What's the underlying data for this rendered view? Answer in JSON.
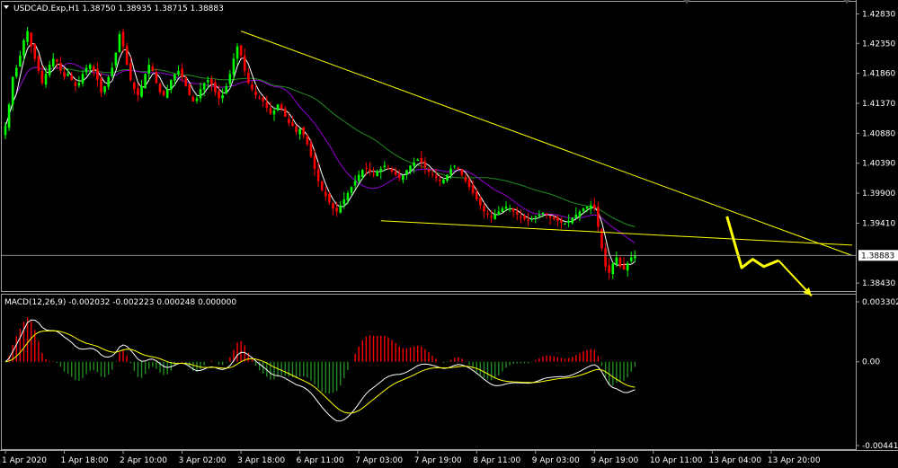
{
  "chart_data": [
    {
      "type": "line",
      "title": "USDCAD.Exp,H1  1.38750 1.38935 1.38715 1.38883",
      "symbol": "USDCAD.Exp,H1",
      "ohlc": [
        "1.38750",
        "1.38935",
        "1.38715",
        "1.38883"
      ],
      "price_ticks": [
        "1.42830",
        "1.42350",
        "1.41860",
        "1.41370",
        "1.40880",
        "1.40390",
        "1.39900",
        "1.39410",
        "1.38430"
      ],
      "price_tick_values": [
        1.4283,
        1.4235,
        1.4186,
        1.4137,
        1.4088,
        1.4039,
        1.399,
        1.3941,
        1.3843
      ],
      "ylim": [
        1.383,
        1.43
      ],
      "current_price": "1.38883",
      "current_price_value": 1.38883,
      "x_labels": [
        "1 Apr 2020",
        "1 Apr 18:00",
        "2 Apr 10:00",
        "3 Apr 02:00",
        "3 Apr 18:00",
        "6 Apr 11:00",
        "7 Apr 03:00",
        "7 Apr 19:00",
        "8 Apr 11:00",
        "9 Apr 03:00",
        "9 Apr 19:00",
        "10 Apr 11:00",
        "13 Apr 04:00",
        "13 Apr 20:00"
      ],
      "x_label_index": [
        0,
        16,
        32,
        48,
        64,
        80,
        96,
        112,
        128,
        144,
        160,
        176,
        192,
        208
      ],
      "close_series": [
        1.41,
        1.4135,
        1.418,
        1.4195,
        1.4215,
        1.424,
        1.4255,
        1.423,
        1.421,
        1.419,
        1.417,
        1.4185,
        1.42,
        1.421,
        1.4205,
        1.419,
        1.418,
        1.4185,
        1.4175,
        1.4165,
        1.417,
        1.4185,
        1.4195,
        1.42,
        1.419,
        1.4175,
        1.4155,
        1.4165,
        1.418,
        1.4195,
        1.422,
        1.425,
        1.423,
        1.42,
        1.4175,
        1.416,
        1.415,
        1.4165,
        1.4185,
        1.42,
        1.419,
        1.417,
        1.4155,
        1.415,
        1.416,
        1.4175,
        1.4185,
        1.419,
        1.418,
        1.4165,
        1.415,
        1.414,
        1.4145,
        1.416,
        1.417,
        1.4175,
        1.4168,
        1.4155,
        1.4145,
        1.415,
        1.4165,
        1.4185,
        1.421,
        1.423,
        1.4215,
        1.419,
        1.417,
        1.416,
        1.415,
        1.4145,
        1.414,
        1.413,
        1.412,
        1.4125,
        1.4135,
        1.4128,
        1.4115,
        1.4105,
        1.41,
        1.409,
        1.4095,
        1.4085,
        1.407,
        1.405,
        1.403,
        1.401,
        1.3995,
        1.3985,
        1.3975,
        1.3965,
        1.396,
        1.397,
        1.398,
        1.399,
        1.4,
        1.401,
        1.402,
        1.4028,
        1.403,
        1.4025,
        1.402,
        1.4026,
        1.403,
        1.4035,
        1.403,
        1.4025,
        1.402,
        1.4015,
        1.402,
        1.4028,
        1.4035,
        1.404,
        1.4045,
        1.404,
        1.4032,
        1.4025,
        1.402,
        1.4015,
        1.401,
        1.4012,
        1.402,
        1.403,
        1.4035,
        1.403,
        1.402,
        1.401,
        1.4,
        1.399,
        1.398,
        1.397,
        1.396,
        1.3955,
        1.395,
        1.3955,
        1.396,
        1.3965,
        1.3968,
        1.3965,
        1.396,
        1.3955,
        1.395,
        1.3948,
        1.3945,
        1.3948,
        1.3952,
        1.3955,
        1.3958,
        1.3955,
        1.395,
        1.3948,
        1.3945,
        1.3942,
        1.394,
        1.3945,
        1.395,
        1.3955,
        1.396,
        1.3965,
        1.3968,
        1.397,
        1.3965,
        1.3935,
        1.39,
        1.387,
        1.386,
        1.3875,
        1.3885,
        1.387,
        1.3865,
        1.3875,
        1.3885,
        1.3888
      ],
      "trendlines": [
        {
          "from": [
            64,
            1.4255
          ],
          "to": [
            230,
            1.3888
          ],
          "color": "#ffff00"
        },
        {
          "from": [
            102,
            1.3945
          ],
          "to": [
            230,
            1.3905
          ],
          "color": "#ffff00"
        }
      ],
      "projection_path": [
        [
          196,
          1.3952
        ],
        [
          200,
          1.3868
        ],
        [
          203,
          1.3882
        ],
        [
          206,
          1.387
        ],
        [
          210,
          1.388
        ]
      ],
      "projection_arrow_end": [
        219,
        1.3822
      ],
      "colors": {
        "up": "#00ff00",
        "down": "#ff0000",
        "ma_fast": "#ffffff",
        "ma_mid": "#9400d3",
        "ma_slow": "#228b22",
        "trend": "#ffff00",
        "bg": "#000000",
        "text": "#ffffff",
        "line": "#a0a0a0"
      }
    },
    {
      "type": "bar",
      "title": "MACD(12,26,9) -0.002032 -0.002223 0.000248 0.000000",
      "label": "MACD(12,26,9)",
      "values_text": [
        "-0.002032",
        "-0.002223",
        "0.000248",
        "0.000000"
      ],
      "y_ticks": [
        "0.003302",
        "0.00",
        "-0.004416"
      ],
      "ylim": [
        -0.004416,
        0.003302
      ],
      "colors": {
        "up": "#ff0000",
        "down": "#228b22",
        "macd": "#ffffff",
        "signal": "#ffff00"
      }
    }
  ]
}
